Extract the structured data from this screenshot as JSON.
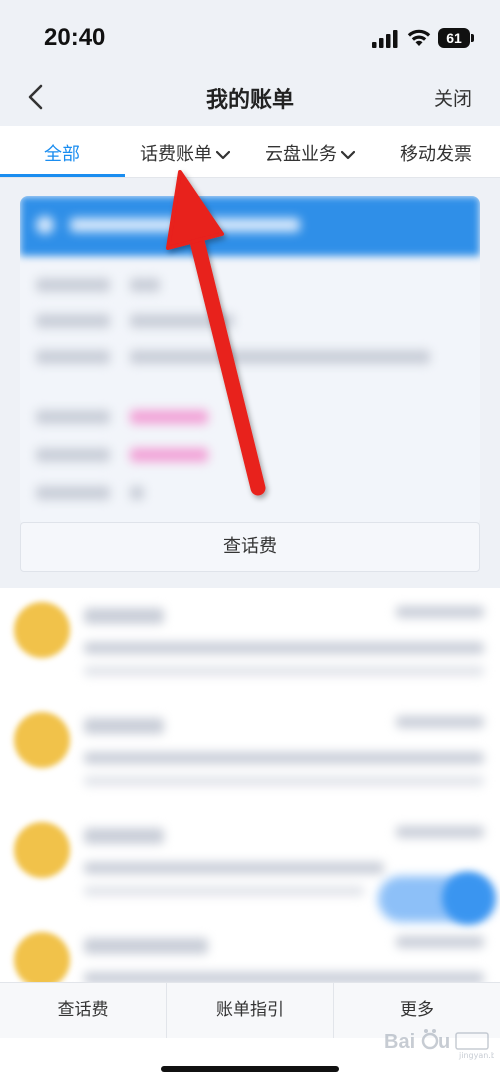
{
  "status_bar": {
    "time": "20:40",
    "battery_level": "61"
  },
  "nav": {
    "back_icon": "chevron-left-icon",
    "title": "我的账单",
    "close_label": "关闭"
  },
  "tabs": [
    {
      "label": "全部",
      "active": true
    },
    {
      "label": "话费账单",
      "has_dropdown": true
    },
    {
      "label": "云盘业务",
      "has_dropdown": true
    },
    {
      "label": "移动发票"
    }
  ],
  "bill_card": {
    "query_button_label": "查话费"
  },
  "bottom_bar": {
    "items": [
      "查话费",
      "账单指引",
      "更多"
    ]
  },
  "colors": {
    "accent": "#1a8df0",
    "annotation_arrow": "#e8201c",
    "avatar": "#f1c24a"
  },
  "watermark": {
    "text": "Baidu 经验"
  }
}
